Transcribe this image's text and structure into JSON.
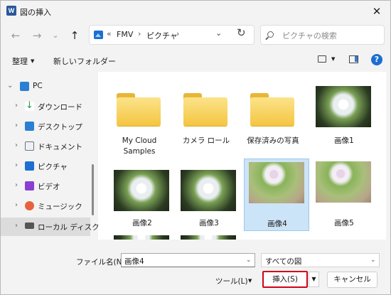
{
  "window": {
    "title": "図の挿入",
    "app_icon": "word-app-icon"
  },
  "address": {
    "overflow": "«",
    "segments": [
      "FMV",
      "ピクチャ"
    ],
    "separator": "›"
  },
  "search": {
    "placeholder": "ピクチャの検索"
  },
  "toolbar": {
    "organize": "整理",
    "new_folder": "新しいフォルダー",
    "help": "?"
  },
  "sidebar": {
    "root": {
      "label": "PC",
      "icon": "pc-icon"
    },
    "items": [
      {
        "label": "ダウンロード",
        "icon": "download-icon",
        "color": "#2a9d4a"
      },
      {
        "label": "デスクトップ",
        "icon": "desktop-icon",
        "color": "#2a7fd4"
      },
      {
        "label": "ドキュメント",
        "icon": "document-icon",
        "color": "#6b7480"
      },
      {
        "label": "ピクチャ",
        "icon": "pictures-icon",
        "color": "#1c6fd1"
      },
      {
        "label": "ビデオ",
        "icon": "video-icon",
        "color": "#8a3fd1"
      },
      {
        "label": "ミュージック",
        "icon": "music-icon",
        "color": "#e5623d"
      },
      {
        "label": "ローカル ディスク (",
        "icon": "drive-icon",
        "color": "#555555"
      }
    ]
  },
  "files": [
    {
      "name": "My Cloud\nSamples",
      "name_l1": "My Cloud",
      "name_l2": "Samples",
      "type": "folder"
    },
    {
      "name": "カメラ ロール",
      "type": "folder"
    },
    {
      "name": "保存済みの写真",
      "type": "folder"
    },
    {
      "name": "画像1",
      "type": "image"
    },
    {
      "name": "画像2",
      "type": "image"
    },
    {
      "name": "画像3",
      "type": "image"
    },
    {
      "name": "画像4",
      "type": "image",
      "selected": true
    },
    {
      "name": "画像5",
      "type": "image"
    }
  ],
  "footer": {
    "filename_label": "ファイル名(N):",
    "filename_value": "画像4",
    "filter_value": "すべての図",
    "tools_label": "ツール(L)",
    "insert_label": "挿入(S)",
    "cancel_label": "キャンセル"
  },
  "colors": {
    "highlight_border": "#d0021b",
    "selection": "#cce4f7",
    "accent": "#1c6fd1"
  }
}
